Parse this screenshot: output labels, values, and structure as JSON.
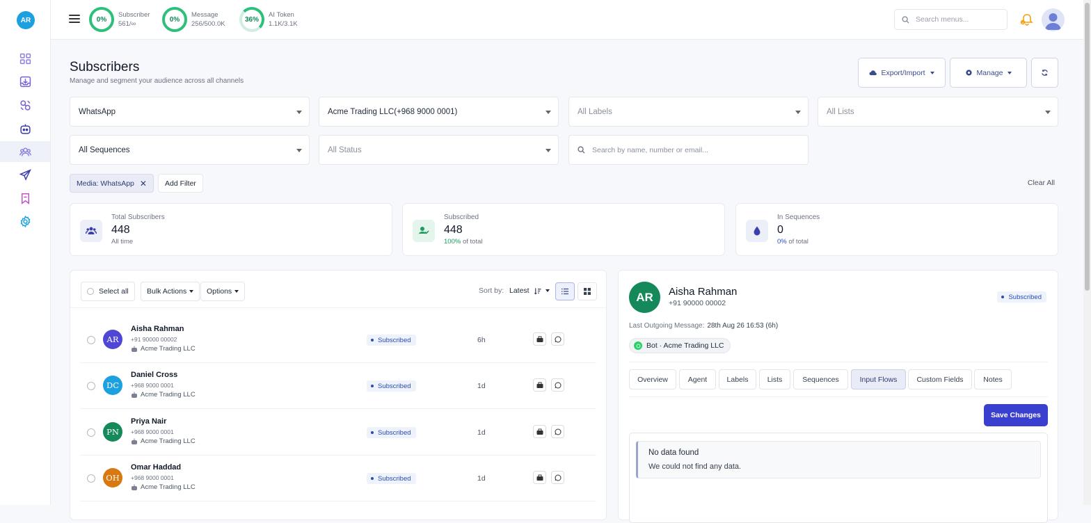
{
  "sidebar": {
    "logo": "AR"
  },
  "topbar": {
    "meters": [
      {
        "percent": "0%",
        "label": "Subscriber",
        "value": "561/∞"
      },
      {
        "percent": "0%",
        "label": "Message",
        "value": "256/500.0K"
      },
      {
        "percent": "36%",
        "label": "AI Token",
        "value": "1.1K/3.1K"
      }
    ],
    "search_placeholder": "Search menus..."
  },
  "page": {
    "title": "Subscribers",
    "subtitle": "Manage and segment your audience across all channels",
    "export_label": "Export/Import",
    "manage_label": "Manage"
  },
  "filters": {
    "channel": "WhatsApp",
    "account": "Acme Trading LLC(+968 9000 0001)",
    "labels": "All Labels",
    "lists": "All Lists",
    "sequences": "All Sequences",
    "status": "All Status",
    "search_placeholder": "Search by name, number or email...",
    "active_chip": "Media: WhatsApp",
    "add_filter": "Add Filter",
    "clear_all": "Clear All"
  },
  "stats": [
    {
      "label": "Total Subscribers",
      "value": "448",
      "sub": "All time",
      "sub_accent": ""
    },
    {
      "label": "Subscribed",
      "value": "448",
      "sub_accent": "100%",
      "sub": "of total"
    },
    {
      "label": "In Sequences",
      "value": "0",
      "sub_accent": "0%",
      "sub": "of total"
    }
  ],
  "list": {
    "select_all": "Select all",
    "bulk_actions": "Bulk Actions",
    "options": "Options",
    "sort_label": "Sort by:",
    "sort_value": "Latest",
    "rows": [
      {
        "initials": "AR",
        "name": "Aisha Rahman",
        "phone": "+91 90000 00002",
        "company": "Acme Trading LLC",
        "status": "Subscribed",
        "time": "6h",
        "color": "#4f46d6"
      },
      {
        "initials": "DC",
        "name": "Daniel Cross",
        "phone": "+968 9000 0001",
        "company": "Acme Trading LLC",
        "status": "Subscribed",
        "time": "1d",
        "color": "#1ca0e0"
      },
      {
        "initials": "PN",
        "name": "Priya Nair",
        "phone": "+968 9000 0001",
        "company": "Acme Trading LLC",
        "status": "Subscribed",
        "time": "1d",
        "color": "#16895b"
      },
      {
        "initials": "OH",
        "name": "Omar Haddad",
        "phone": "+968 9000 0001",
        "company": "Acme Trading LLC",
        "status": "Subscribed",
        "time": "1d",
        "color": "#d9780f"
      }
    ]
  },
  "detail": {
    "initials": "AR",
    "name": "Aisha Rahman",
    "phone": "+91 90000 00002",
    "status": "Subscribed",
    "last_msg_label": "Last Outgoing Message:",
    "last_msg_value": "28th Aug 26 16:53 (6h)",
    "bot": "Bot · Acme Trading LLC",
    "tabs": [
      "Overview",
      "Agent",
      "Labels",
      "Lists",
      "Sequences",
      "Input Flows",
      "Custom Fields",
      "Notes"
    ],
    "active_tab": "Input Flows",
    "save_label": "Save Changes",
    "empty_title": "No data found",
    "empty_text": "We could not find any data."
  }
}
